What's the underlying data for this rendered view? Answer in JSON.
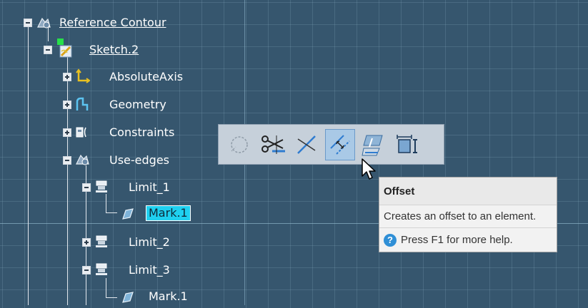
{
  "tree": {
    "reference_contour": "Reference Contour",
    "sketch": "Sketch.2",
    "absolute_axis": "AbsoluteAxis",
    "geometry": "Geometry",
    "constraints": "Constraints",
    "use_edges": "Use-edges",
    "limit_1": "Limit_1",
    "mark_1_selected": "Mark.1",
    "limit_2": "Limit_2",
    "limit_3": "Limit_3",
    "mark_1": "Mark.1"
  },
  "toolbar": {
    "buttons": [
      {
        "icon": "dashed-circle-icon",
        "state": "disabled"
      },
      {
        "icon": "scissors-trim-icon",
        "state": "normal"
      },
      {
        "icon": "break-icon",
        "state": "normal"
      },
      {
        "icon": "offset-icon",
        "state": "hover"
      },
      {
        "icon": "project-edges-icon",
        "state": "normal"
      },
      {
        "icon": "dimension-frame-icon",
        "state": "normal"
      }
    ]
  },
  "tooltip": {
    "title": "Offset",
    "description": "Creates an offset to an element.",
    "help": "Press F1 for more help."
  },
  "colors": {
    "background": "#36566e",
    "selection": "#1fd0f0",
    "toolbar": "#c6d0da",
    "hover": "#a9c9e6"
  }
}
